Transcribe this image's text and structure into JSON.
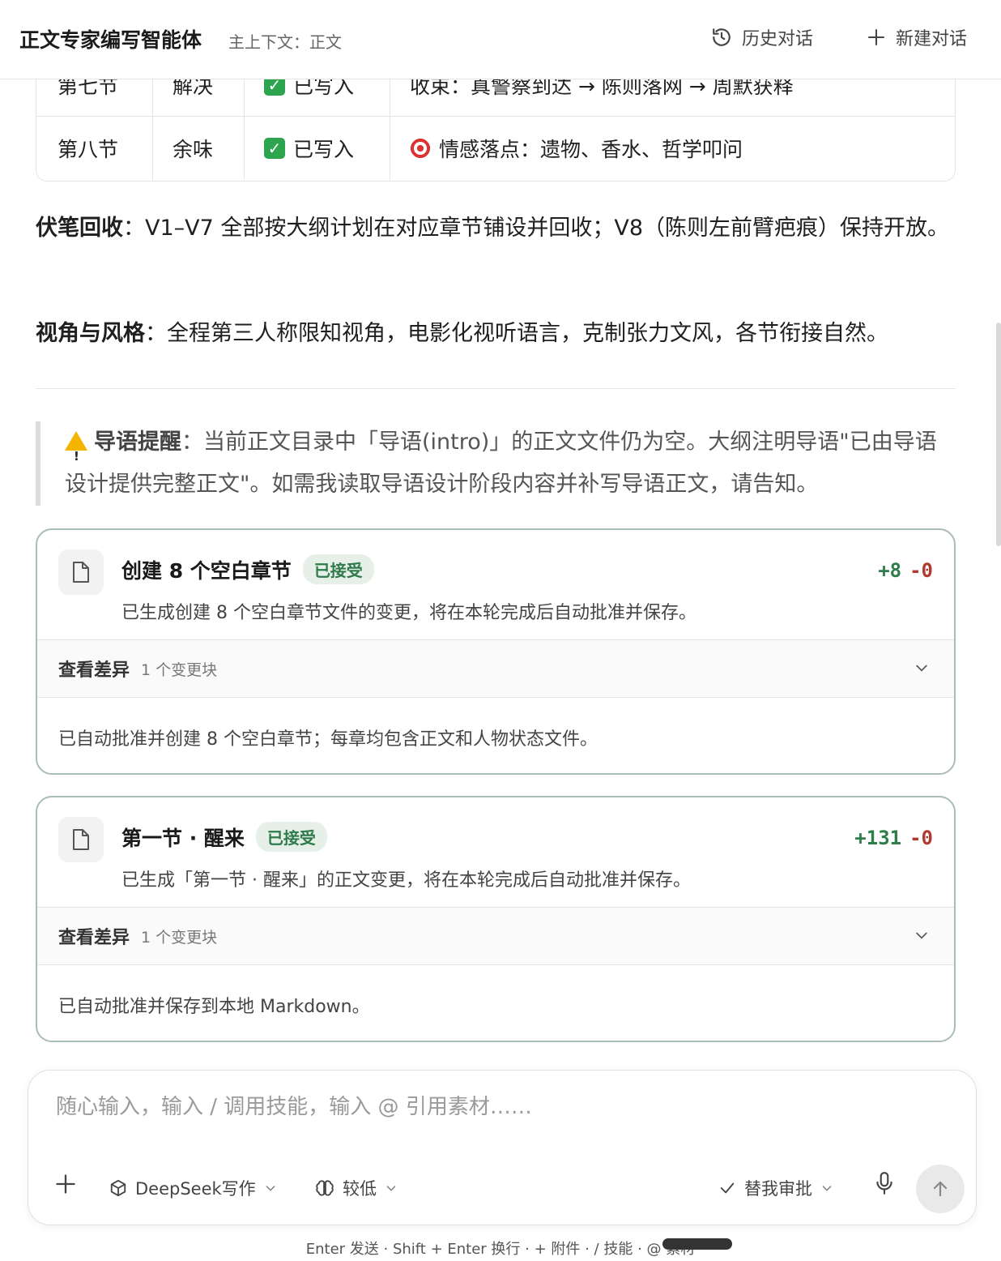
{
  "header": {
    "title": "正文专家编写智能体",
    "context": "主上下文：正文",
    "history_label": "历史对话",
    "new_label": "新建对话"
  },
  "table": {
    "rows": [
      {
        "section": "第七节",
        "name": "解决",
        "status": "已写入",
        "note": "收束：真警察到达 → 陈则落网 → 周默获释"
      },
      {
        "section": "第八节",
        "name": "余味",
        "status": "已写入",
        "note": "情感落点：遗物、香水、哲学叩问"
      }
    ]
  },
  "paragraphs": {
    "p1_bold": "伏笔回收",
    "p1_text": "：V1–V7 全部按大纲计划在对应章节铺设并回收；V8（陈则左前臂疤痕）保持开放。",
    "p2_bold": "视角与风格",
    "p2_text": "：全程第三人称限知视角，电影化视听语言，克制张力文风，各节衔接自然。"
  },
  "quote": {
    "bold": "导语提醒",
    "text": "：当前正文目录中「导语(intro)」的正文文件仍为空。大纲注明导语\"已由导语设计提供完整正文\"。如需我读取导语设计阶段内容并补写导语正文，请告知。"
  },
  "cards": [
    {
      "title": "创建 8 个空白章节",
      "badge": "已接受",
      "add": "+8",
      "del": "-0",
      "desc": "已生成创建 8 个空白章节文件的变更，将在本轮完成后自动批准并保存。",
      "diff_label": "查看差异",
      "diff_count": "1 个变更块",
      "foot": "已自动批准并创建 8 个空白章节；每章均包含正文和人物状态文件。"
    },
    {
      "title": "第一节 · 醒来",
      "badge": "已接受",
      "add": "+131",
      "del": "-0",
      "desc": "已生成「第一节 · 醒来」的正文变更，将在本轮完成后自动批准并保存。",
      "diff_label": "查看差异",
      "diff_count": "1 个变更块",
      "foot": "已自动批准并保存到本地 Markdown。"
    }
  ],
  "composer": {
    "placeholder": "随心输入，输入 / 调用技能，输入 @ 引用素材……",
    "model": "DeepSeek写作",
    "level": "较低",
    "review": "替我审批"
  },
  "hint": "Enter 发送 · Shift + Enter 换行 · + 附件 · / 技能 · @ 素材"
}
